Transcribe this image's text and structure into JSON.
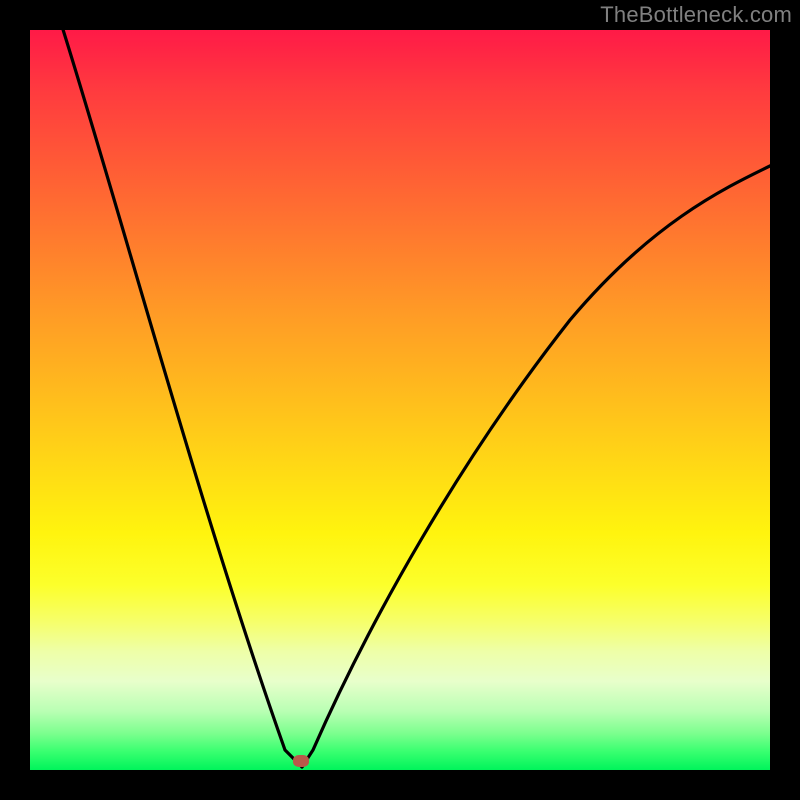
{
  "watermark": "TheBottleneck.com",
  "accent_colors": {
    "top": "#ff1a47",
    "mid": "#ffd616",
    "bottom": "#00f45b",
    "curve": "#000000",
    "marker": "#b85a4a",
    "frame": "#000000"
  },
  "chart_data": {
    "type": "line",
    "title": "",
    "xlabel": "",
    "ylabel": "",
    "xlim": [
      0,
      100
    ],
    "ylim": [
      0,
      100
    ],
    "grid": false,
    "legend": false,
    "annotations": [
      "TheBottleneck.com"
    ],
    "series": [
      {
        "name": "bottleneck-curve",
        "x": [
          0,
          3,
          6,
          9,
          12,
          15,
          18,
          21,
          24,
          27,
          30,
          32,
          34,
          35,
          36,
          37,
          38,
          40,
          42,
          45,
          48,
          52,
          56,
          60,
          65,
          70,
          76,
          82,
          88,
          94,
          100
        ],
        "y": [
          100,
          92,
          84,
          76,
          68,
          60,
          52,
          44,
          36,
          28,
          20,
          14,
          8,
          5,
          2,
          2,
          4,
          8,
          13,
          20,
          27,
          35,
          42,
          48,
          55,
          60,
          66,
          71,
          75,
          79,
          82
        ]
      }
    ],
    "marker": {
      "x": 36,
      "y": 1.5
    }
  }
}
